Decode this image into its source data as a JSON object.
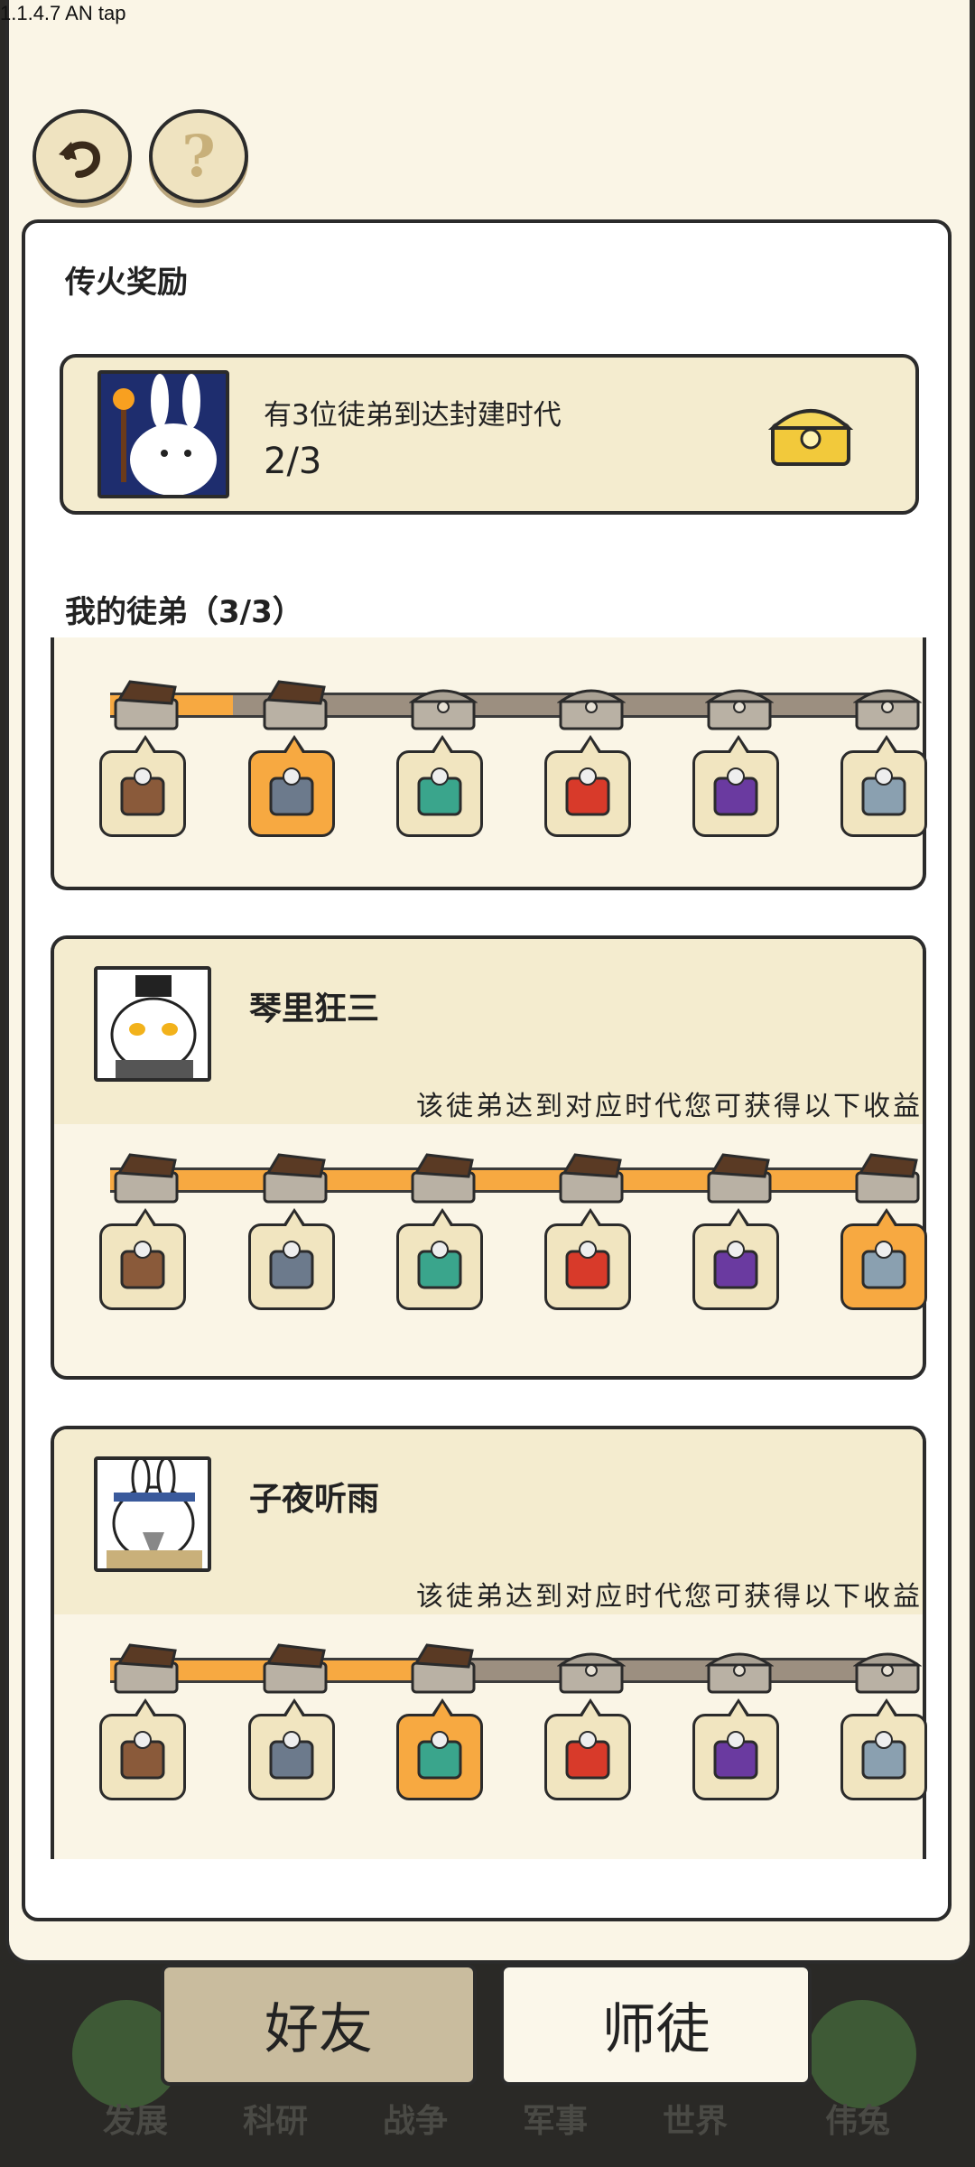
{
  "version": "1.1.4.7 AN tap",
  "header": {
    "back_icon": "back-arrow-icon",
    "help_icon": "question-icon"
  },
  "reward_section": {
    "title": "传火奖励",
    "task_text": "有3位徒弟到达封建时代",
    "progress": "2/3"
  },
  "disciples_section": {
    "title": "我的徒弟（3/3）"
  },
  "disciples": [
    {
      "name": "",
      "note": "",
      "progress_filled": 1,
      "active_era": 1
    },
    {
      "name": "琴里狂三",
      "note": "该徒弟达到对应时代您可获得以下收益",
      "progress_filled": 5,
      "active_era": 5
    },
    {
      "name": "子夜听雨",
      "note": "该徒弟达到对应时代您可获得以下收益",
      "progress_filled": 2,
      "active_era": 2
    }
  ],
  "eras": [
    "stone-age-icon",
    "ancient-age-icon",
    "bronze-age-icon",
    "feudal-age-icon",
    "industrial-age-icon",
    "modern-age-icon"
  ],
  "tabs": {
    "friends": "好友",
    "mentor": "师徒"
  },
  "nav": [
    "发展",
    "科研",
    "战争",
    "军事",
    "世界",
    "伟兔"
  ],
  "colors": {
    "accent": "#f7a941",
    "panel": "#f4eccf",
    "border": "#2b2b2b"
  }
}
